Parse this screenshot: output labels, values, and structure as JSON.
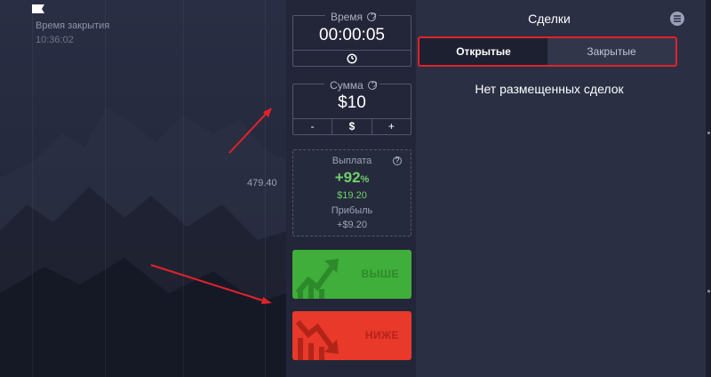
{
  "chart": {
    "close_label": "Время закрытия",
    "close_time": "10:36:02",
    "price_label": "479.40"
  },
  "trade_panel": {
    "time": {
      "label": "Время",
      "value": "00:00:05",
      "footer_icon": "timer-icon"
    },
    "amount": {
      "label": "Сумма",
      "value": "$10",
      "minus": "-",
      "currency": "$",
      "plus": "+"
    },
    "payout": {
      "label": "Выплата",
      "percent": "+92",
      "percent_unit": "%",
      "amount": "$19.20",
      "profit_label": "Прибыль",
      "profit_amount": "+$9.20"
    },
    "up_button": "ВЫШЕ",
    "down_button": "НИЖЕ"
  },
  "deals": {
    "title": "Сделки",
    "tabs": [
      {
        "label": "Открытые",
        "active": true
      },
      {
        "label": "Закрытые",
        "active": false
      }
    ],
    "empty_message": "Нет размещенных сделок"
  },
  "colors": {
    "up": "#3fae3a",
    "down": "#e8392b",
    "payout": "#6fd16a",
    "highlight": "#e2222a"
  }
}
